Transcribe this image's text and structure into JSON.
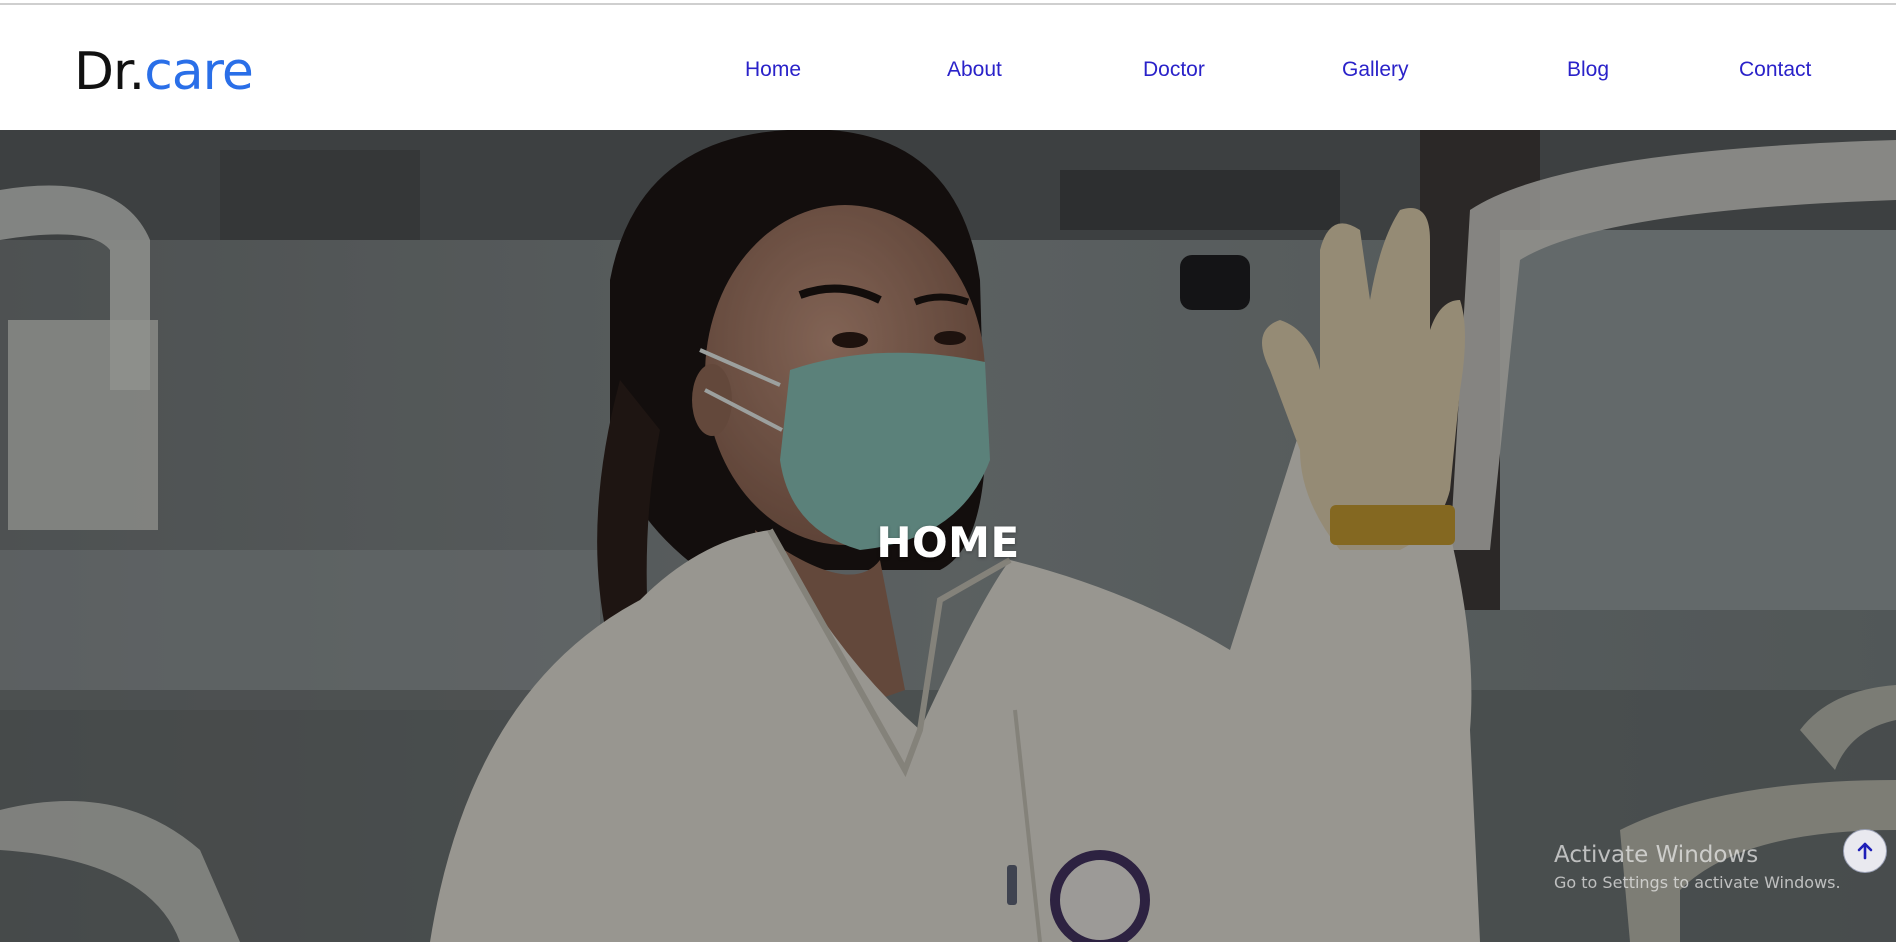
{
  "brand": {
    "prefix": "Dr.",
    "suffix": "care",
    "accent": "#2a6fe8"
  },
  "nav": {
    "color": "#2a22c9",
    "items": [
      {
        "label": "Home"
      },
      {
        "label": "About"
      },
      {
        "label": "Doctor"
      },
      {
        "label": "Gallery"
      },
      {
        "label": "Blog"
      },
      {
        "label": "Contact"
      }
    ]
  },
  "hero": {
    "title": "HOME",
    "image": "doctor-with-face-mask-in-lab"
  },
  "watermark": {
    "title": "Activate Windows",
    "subtitle": "Go to Settings to activate Windows."
  },
  "controls": {
    "back_to_top_icon": "arrow-up-icon"
  }
}
